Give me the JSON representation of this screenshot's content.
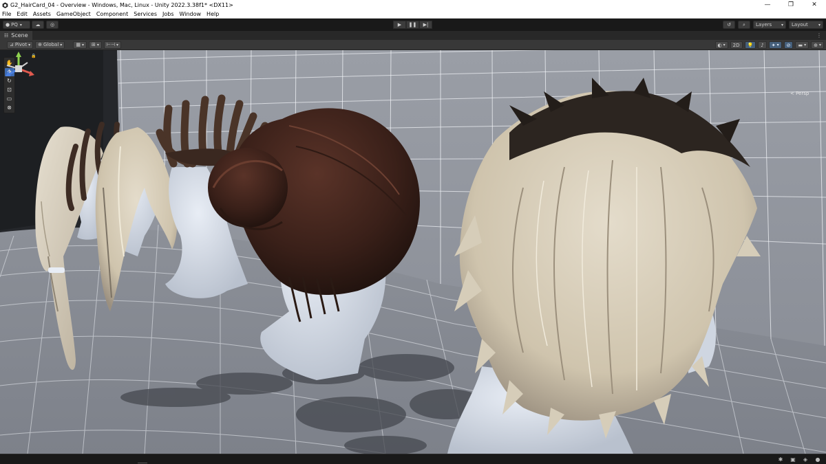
{
  "window": {
    "title": "G2_HairCard_04 - Overview - Windows, Mac, Linux - Unity 2022.3.38f1* <DX11>",
    "controls": [
      "—",
      "❐",
      "✕"
    ]
  },
  "menu": [
    "File",
    "Edit",
    "Assets",
    "GameObject",
    "Component",
    "Services",
    "Jobs",
    "Window",
    "Help"
  ],
  "toolbar": {
    "account_label": "PQ",
    "layers_label": "Layers",
    "layout_label": "Layout"
  },
  "scene_tab": {
    "label": "Scene"
  },
  "scene_toolbar": {
    "pivot_label": "Pivot",
    "global_label": "Global",
    "mode_2d_label": "2D"
  },
  "viewport": {
    "camera_label": "< Persp"
  },
  "colors": {
    "accent": "#3d6bb3",
    "viewport_bg": "#8a8e96"
  }
}
